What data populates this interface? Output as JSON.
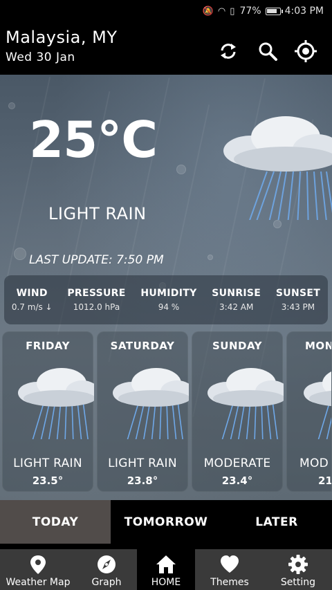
{
  "status_bar": {
    "battery": "77%",
    "time": "4:03 PM"
  },
  "header": {
    "location": "Malaysia, MY",
    "date": "Wed 30 Jan"
  },
  "current": {
    "temperature": "25°C",
    "condition": "LIGHT RAIN",
    "last_update": "LAST UPDATE: 7:50 PM"
  },
  "stats": [
    {
      "label": "WIND",
      "value": "0.7 m/s ↓"
    },
    {
      "label": "PRESSURE",
      "value": "1012.0 hPa"
    },
    {
      "label": "HUMIDITY",
      "value": "94 %"
    },
    {
      "label": "SUNRISE",
      "value": "3:42 AM"
    },
    {
      "label": "SUNSET",
      "value": "3:43 PM"
    }
  ],
  "forecast": [
    {
      "day": "FRIDAY",
      "condition": "LIGHT RAIN",
      "temp": "23.5°"
    },
    {
      "day": "SATURDAY",
      "condition": "LIGHT RAIN",
      "temp": "23.8°"
    },
    {
      "day": "SUNDAY",
      "condition": "MODERATE",
      "temp": "23.4°"
    },
    {
      "day": "MON",
      "condition": "MOD",
      "temp": "21"
    }
  ],
  "tabs": [
    {
      "label": "TODAY",
      "active": true
    },
    {
      "label": "TOMORROW",
      "active": false
    },
    {
      "label": "LATER",
      "active": false
    }
  ],
  "nav": [
    {
      "label": "Weather Map",
      "icon": "map-pin-icon"
    },
    {
      "label": "Graph",
      "icon": "compass-icon"
    },
    {
      "label": "HOME",
      "icon": "home-icon",
      "active": true
    },
    {
      "label": "Themes",
      "icon": "heart-icon"
    },
    {
      "label": "Setting",
      "icon": "gear-icon"
    }
  ],
  "colors": {
    "active_tab": "#514c4a",
    "nav_bg": "#3a3a3a",
    "rain": "#6fa8e8"
  }
}
